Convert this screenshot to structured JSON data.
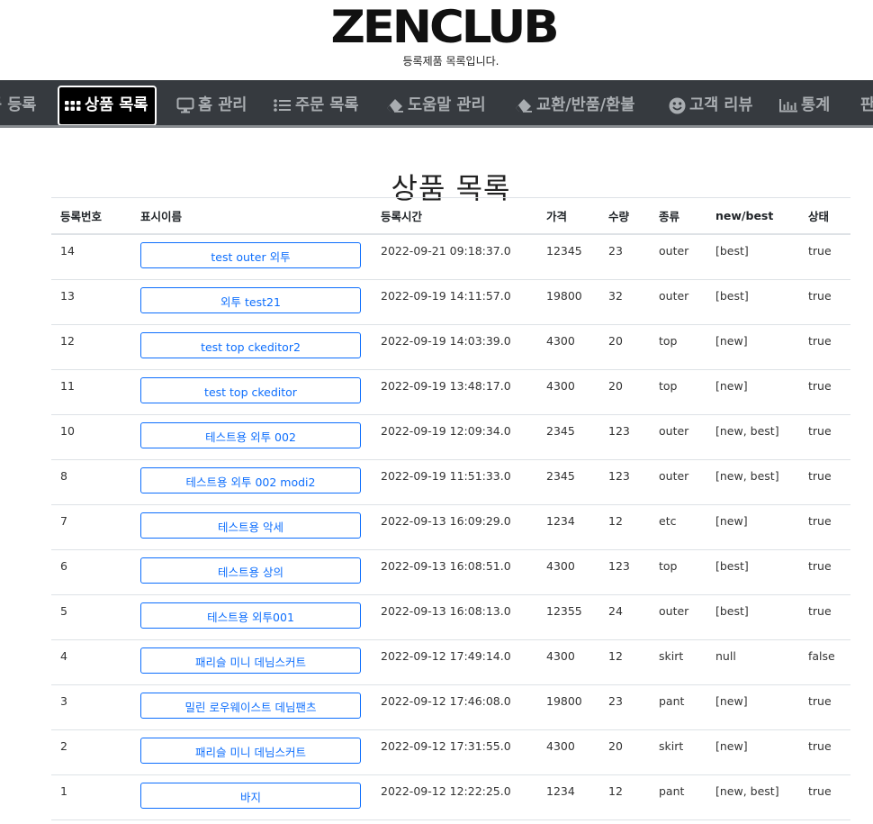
{
  "brand": "ZENCLUB",
  "tagline": "등록제품 목록입니다.",
  "nav": [
    {
      "label": "품 등록",
      "icon": "none"
    },
    {
      "label": "상품 목록",
      "icon": "grid-icon",
      "active": true
    },
    {
      "label": "홈 관리",
      "icon": "monitor-icon"
    },
    {
      "label": "주문 목록",
      "icon": "list-icon"
    },
    {
      "label": "도움말 관리",
      "icon": "eraser-icon"
    },
    {
      "label": "교환/반품/환불",
      "icon": "eraser-icon"
    },
    {
      "label": "고객 리뷰",
      "icon": "smile-icon"
    },
    {
      "label": "통계",
      "icon": "bar-chart-icon"
    },
    {
      "label": "판",
      "icon": "none"
    }
  ],
  "page_title": "상품 목록",
  "table": {
    "headers": [
      "등록번호",
      "표시이름",
      "등록시간",
      "가격",
      "수량",
      "종류",
      "new/best",
      "상태"
    ],
    "rows": [
      {
        "id": "14",
        "name": "test outer 외투",
        "time": "2022-09-21 09:18:37.0",
        "price": "12345",
        "qty": "23",
        "type": "outer",
        "tag": "[best]",
        "status": "true"
      },
      {
        "id": "13",
        "name": "외투 test21",
        "time": "2022-09-19 14:11:57.0",
        "price": "19800",
        "qty": "32",
        "type": "outer",
        "tag": "[best]",
        "status": "true"
      },
      {
        "id": "12",
        "name": "test top ckeditor2",
        "time": "2022-09-19 14:03:39.0",
        "price": "4300",
        "qty": "20",
        "type": "top",
        "tag": "[new]",
        "status": "true"
      },
      {
        "id": "11",
        "name": "test top ckeditor",
        "time": "2022-09-19 13:48:17.0",
        "price": "4300",
        "qty": "20",
        "type": "top",
        "tag": "[new]",
        "status": "true"
      },
      {
        "id": "10",
        "name": "테스트용 외투 002",
        "time": "2022-09-19 12:09:34.0",
        "price": "2345",
        "qty": "123",
        "type": "outer",
        "tag": "[new, best]",
        "status": "true"
      },
      {
        "id": "8",
        "name": "테스트용 외투 002 modi2",
        "time": "2022-09-19 11:51:33.0",
        "price": "2345",
        "qty": "123",
        "type": "outer",
        "tag": "[new, best]",
        "status": "true"
      },
      {
        "id": "7",
        "name": "테스트용 악세",
        "time": "2022-09-13 16:09:29.0",
        "price": "1234",
        "qty": "12",
        "type": "etc",
        "tag": "[new]",
        "status": "true"
      },
      {
        "id": "6",
        "name": "테스트용 상의",
        "time": "2022-09-13 16:08:51.0",
        "price": "4300",
        "qty": "123",
        "type": "top",
        "tag": "[best]",
        "status": "true"
      },
      {
        "id": "5",
        "name": "테스트용 외투001",
        "time": "2022-09-13 16:08:13.0",
        "price": "12355",
        "qty": "24",
        "type": "outer",
        "tag": "[best]",
        "status": "true"
      },
      {
        "id": "4",
        "name": "패리슬 미니 데님스커트",
        "time": "2022-09-12 17:49:14.0",
        "price": "4300",
        "qty": "12",
        "type": "skirt",
        "tag": "null",
        "status": "false"
      },
      {
        "id": "3",
        "name": "밀린 로우웨이스트 데님팬츠",
        "time": "2022-09-12 17:46:08.0",
        "price": "19800",
        "qty": "23",
        "type": "pant",
        "tag": "[new]",
        "status": "true"
      },
      {
        "id": "2",
        "name": "패리슬 미니 데님스커트",
        "time": "2022-09-12 17:31:55.0",
        "price": "4300",
        "qty": "20",
        "type": "skirt",
        "tag": "[new]",
        "status": "true"
      },
      {
        "id": "1",
        "name": "바지",
        "time": "2022-09-12 12:22:25.0",
        "price": "1234",
        "qty": "12",
        "type": "pant",
        "tag": "[new, best]",
        "status": "true"
      }
    ]
  },
  "colors": {
    "navbar": "#363a3f",
    "accent": "#0d6efd"
  }
}
